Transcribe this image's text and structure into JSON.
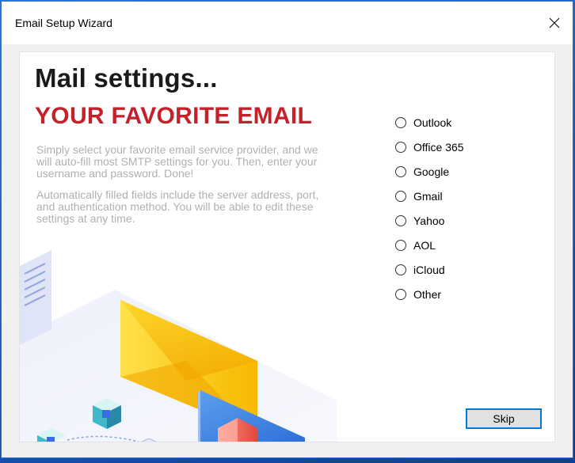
{
  "window": {
    "title": "Email Setup Wizard"
  },
  "main": {
    "heading": "Mail settings...",
    "subheading": "YOUR FAVORITE EMAIL",
    "paragraph1": "Simply select your favorite email service provider, and we will auto-fill most SMTP settings for you. Then, enter your username and password. Done!",
    "paragraph2": "Automatically filled fields include the server address, port, and authentication method. You will be able to edit these settings at any time."
  },
  "providers": [
    "Outlook",
    "Office 365",
    "Google",
    "Gmail",
    "Yahoo",
    "AOL",
    "iCloud",
    "Other"
  ],
  "buttons": {
    "skip": "Skip"
  },
  "colors": {
    "accent": "#c4212b",
    "focus": "#0078d7"
  },
  "icons": {
    "close": "close-icon"
  }
}
